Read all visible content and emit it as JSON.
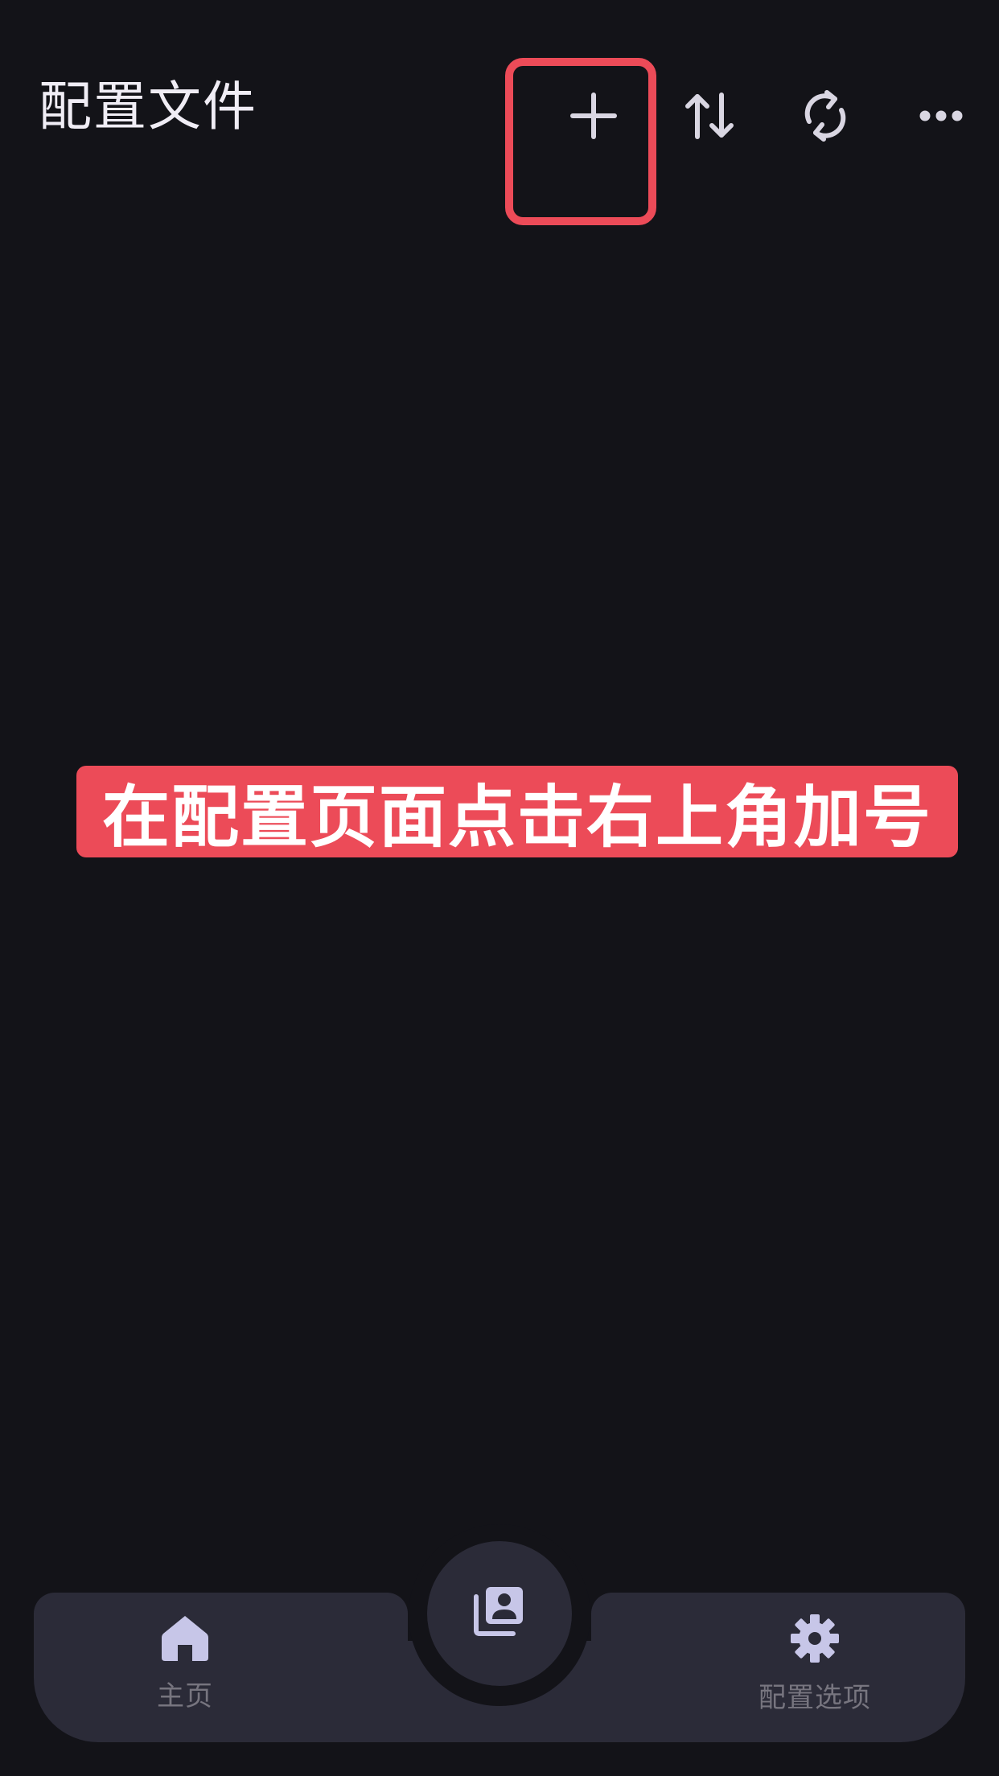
{
  "header": {
    "title": "配置文件",
    "actions": [
      {
        "name": "add-icon"
      },
      {
        "name": "sort-icon"
      },
      {
        "name": "refresh-icon"
      },
      {
        "name": "more-icon"
      }
    ]
  },
  "annotation": {
    "text": "在配置页面点击右上角加号",
    "color": "#ec4b58"
  },
  "bottom_nav": {
    "home_label": "主页",
    "center_icon": "profiles-icon",
    "settings_label": "配置选项",
    "active_icon_color": "#c7c6e8"
  },
  "colors": {
    "background": "#131318",
    "nav_surface": "#2b2b38",
    "highlight": "#ec4b58"
  }
}
